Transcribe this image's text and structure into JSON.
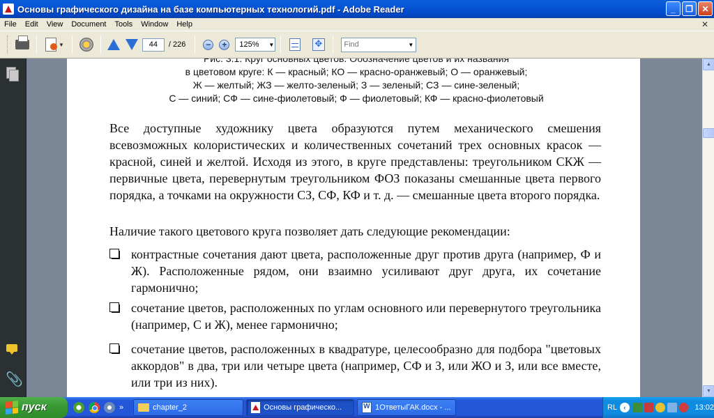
{
  "window": {
    "title": "Основы графического дизайна на базе компьютерных технологий.pdf - Adobe Reader",
    "minimize": "_",
    "maximize": "❐",
    "close": "✕"
  },
  "menu": [
    "File",
    "Edit",
    "View",
    "Document",
    "Tools",
    "Window",
    "Help"
  ],
  "menu_close": "✕",
  "toolbar": {
    "page_current": "44",
    "page_total": "/ 226",
    "zoom": "125%",
    "find_placeholder": "Find",
    "zoom_out": "−",
    "zoom_in": "+"
  },
  "document": {
    "caption_line1": "Рис. 3.1. Круг основных цветов. Обозначение цветов и их названия",
    "caption_line2": "в цветовом круге: К — красный; КО — красно-оранжевый; О — оранжевый;",
    "caption_line3": "Ж — желтый; ЖЗ — желто-зеленый; З — зеленый; СЗ — сине-зеленый;",
    "caption_line4": "С — синий; СФ — сине-фиолетовый; Ф — фиолетовый; КФ — красно-фиолетовый",
    "paragraph1": "Все доступные художнику цвета образуются путем механического смешения всевозможных колористических и количественных сочетаний трех основных красок — красной, синей и желтой. Исходя из этого, в круге представлены: треугольником СКЖ — первичные цвета, перевернутым треугольником ФОЗ показаны смешанные цвета первого порядка, а точками на окружности СЗ, СФ, КФ и т. д. — смешанные цвета второго порядка.",
    "paragraph2": "Наличие такого цветового круга позволяет дать следующие рекомендации:",
    "bullets": [
      "контрастные сочетания дают цвета, расположенные друг против друга (например, Ф и Ж). Расположенные рядом, они взаимно усиливают друг друга, их сочетание гармонично;",
      "сочетание цветов, расположенных по углам основного или перевернутого треугольника (например, С и Ж), менее гармонично;",
      "сочетание цветов, расположенных в квадратуре, целесообразно для подбора \"цветовых аккордов\" в два, три или четыре цвета (например, СФ и З, или ЖО и З, или все вместе, или три из них)."
    ]
  },
  "taskbar": {
    "start": "пуск",
    "more": "»",
    "tasks": [
      {
        "label": "chapter_2",
        "icon": "folder-icon"
      },
      {
        "label": "Основы графическо...",
        "icon": "pdf-icon"
      },
      {
        "label": "1ОтветыГАК.docx - ...",
        "icon": "word-icon"
      }
    ],
    "lang": "RL",
    "chevron": "‹",
    "clock": "13:02"
  }
}
